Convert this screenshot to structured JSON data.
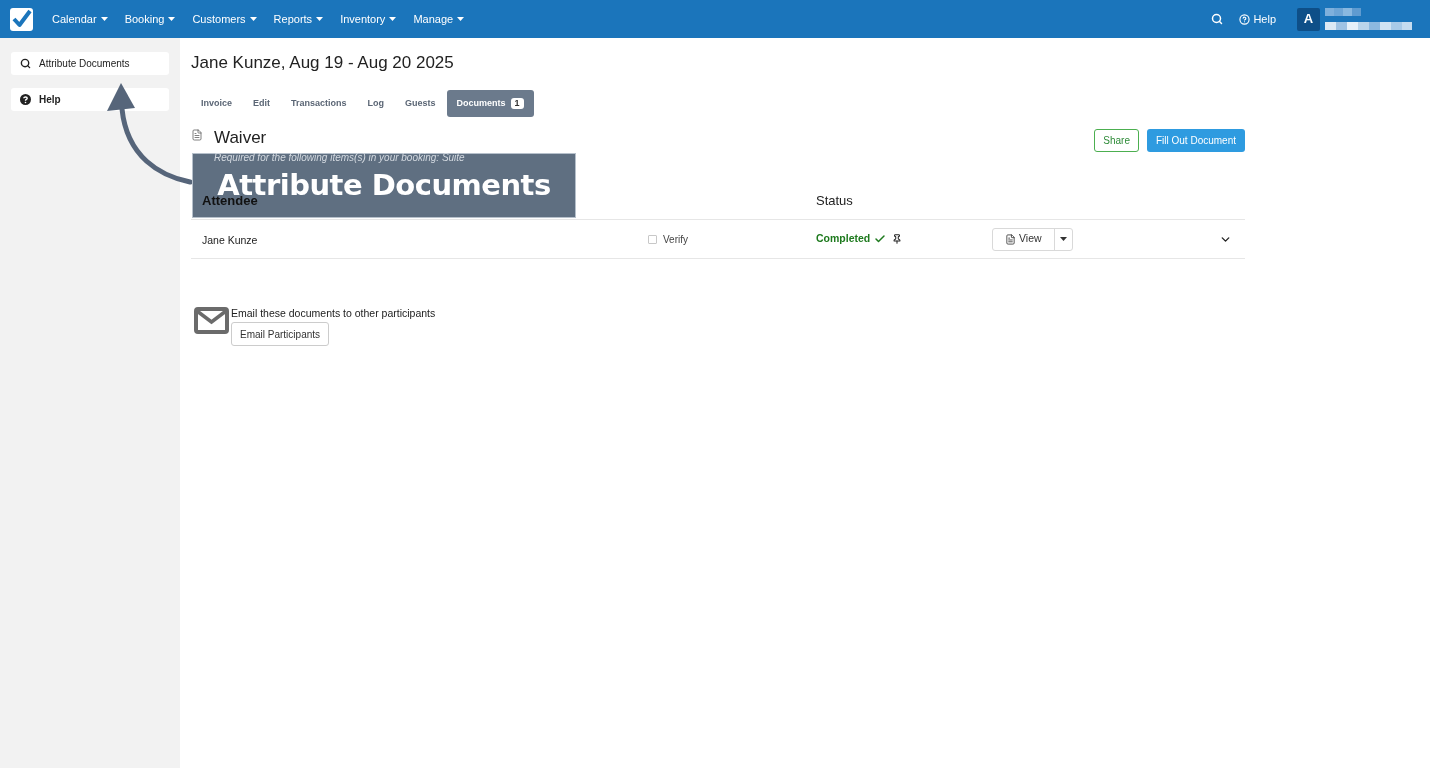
{
  "nav": {
    "menus": [
      {
        "label": "Calendar"
      },
      {
        "label": "Booking"
      },
      {
        "label": "Customers"
      },
      {
        "label": "Reports"
      },
      {
        "label": "Inventory"
      },
      {
        "label": "Manage"
      }
    ],
    "help": "Help",
    "avatar": "A"
  },
  "sidebar": {
    "items": [
      {
        "kind": "search",
        "label": "Attribute Documents"
      },
      {
        "kind": "help",
        "label": "Help"
      }
    ]
  },
  "title": "Jane Kunze, Aug 19 - Aug 20 2025",
  "tabs": [
    {
      "label": "Invoice",
      "selected": false
    },
    {
      "label": "Edit",
      "selected": false
    },
    {
      "label": "Transactions",
      "selected": false
    },
    {
      "label": "Log",
      "selected": false
    },
    {
      "label": "Guests",
      "selected": false
    },
    {
      "label": "Documents",
      "selected": true,
      "badge": "1"
    }
  ],
  "document": {
    "title": "Waiver",
    "note": "Required for the following items(s) in your booking: Suite",
    "buttons": [
      {
        "kind": "outline",
        "label": "Share"
      },
      {
        "kind": "primary",
        "label": "Fill Out Document"
      }
    ],
    "columns": [
      "Attendee",
      "Status"
    ],
    "rows": [
      {
        "attendee": "Jane Kunze",
        "verify": {
          "label": "Verify",
          "checked": false
        },
        "status": "Completed",
        "view": "View"
      }
    ]
  },
  "email": {
    "text": "Email these documents to other participants",
    "button": "Email Participants"
  },
  "callout": {
    "text": "Attribute Documents"
  }
}
